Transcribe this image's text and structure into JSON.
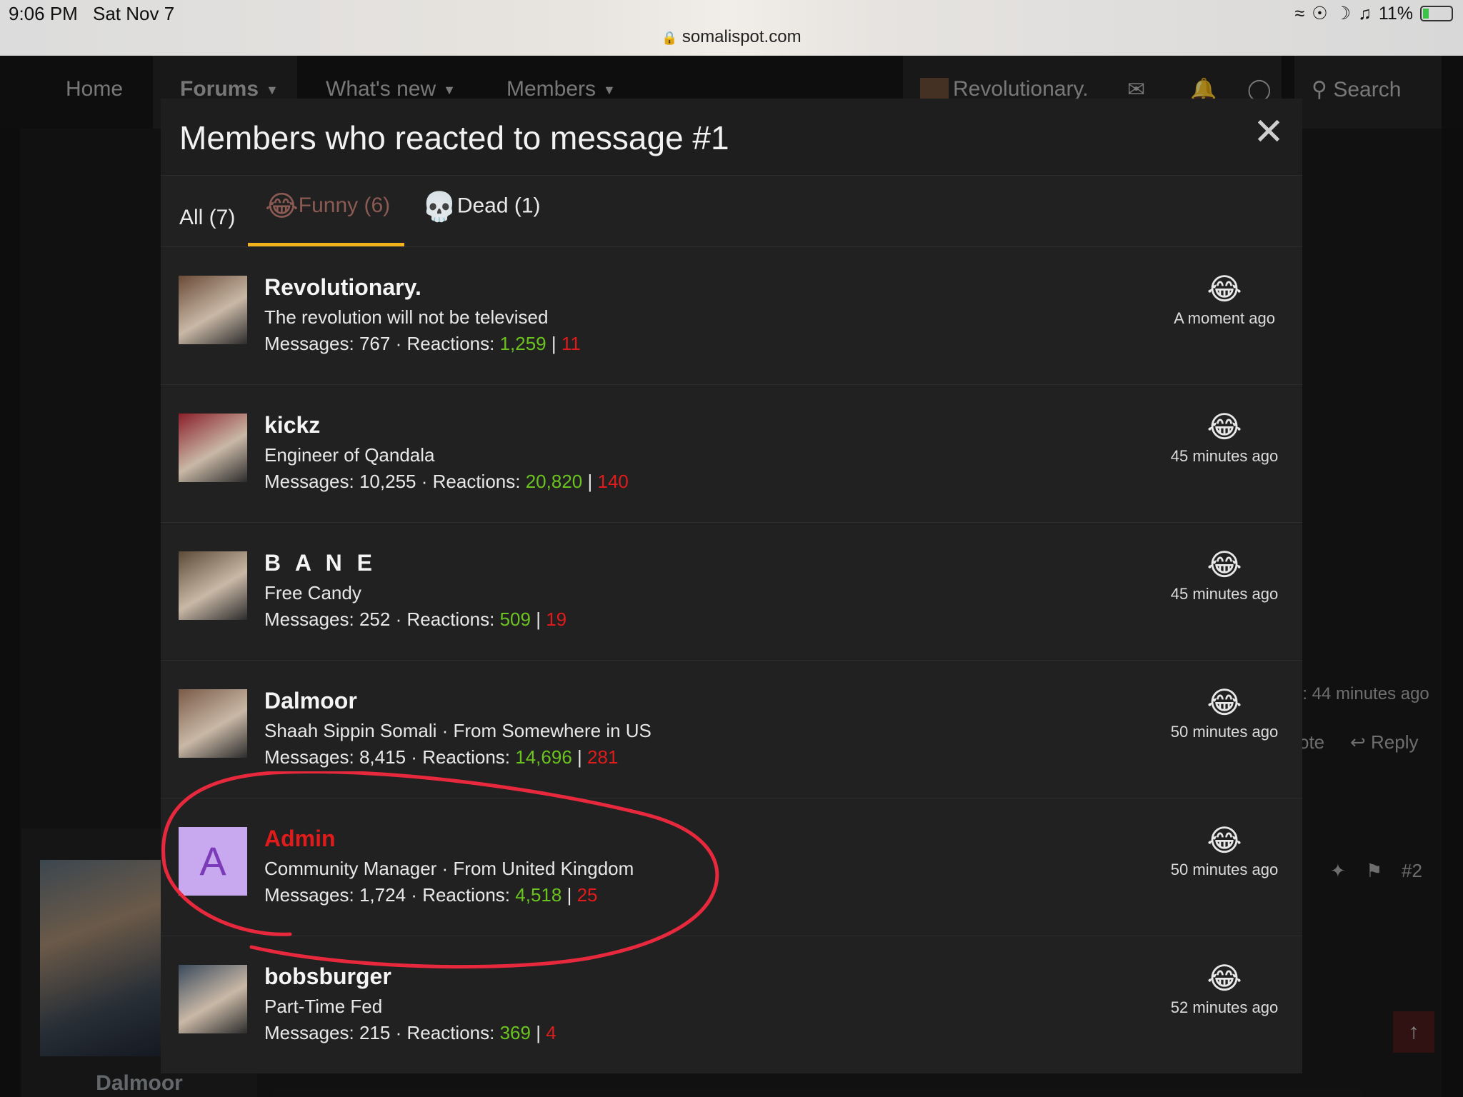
{
  "status_bar": {
    "time": "9:06 PM",
    "date": "Sat Nov 7",
    "battery": "11%",
    "url": "somalispot.com"
  },
  "nav": {
    "home": "Home",
    "forums": "Forums",
    "whats_new": "What's new",
    "members": "Members",
    "user": "Revolutionary.",
    "search": "Search"
  },
  "background": {
    "meta_time": "l: 44 minutes ago",
    "quote": "ote",
    "reply": "Reply",
    "post_number": "#2",
    "author": "Dalmoor"
  },
  "modal": {
    "title": "Members who reacted to message #1",
    "tabs": [
      {
        "label": "All (7)"
      },
      {
        "label": "Funny (6)",
        "emoji": "😂"
      },
      {
        "label": "Dead (1)",
        "emoji": "💀"
      }
    ]
  },
  "members": [
    {
      "name": "Revolutionary.",
      "title": "The revolution will not be televised",
      "messages": "767",
      "reactions_pos": "1,259",
      "reactions_neg": "11",
      "reaction": "😂",
      "when": "A moment ago",
      "avatar_color": "#6a4a38"
    },
    {
      "name": "kickz",
      "title": "Engineer of Qandala",
      "messages": "10,255",
      "reactions_pos": "20,820",
      "reactions_neg": "140",
      "reaction": "😂",
      "when": "45 minutes ago",
      "avatar_color": "#8a1f2a"
    },
    {
      "name": "B A N E",
      "title": "Free Candy",
      "messages": "252",
      "reactions_pos": "509",
      "reactions_neg": "19",
      "reaction": "😂",
      "when": "45 minutes ago",
      "avatar_color": "#5c4a38"
    },
    {
      "name": "Dalmoor",
      "title": "Shaah Sippin Somali · From Somewhere in US",
      "messages": "8,415",
      "reactions_pos": "14,696",
      "reactions_neg": "281",
      "reaction": "😂",
      "when": "50 minutes ago",
      "avatar_color": "#7a5a48"
    },
    {
      "name": "Admin",
      "title": "Community Manager · From United Kingdom",
      "messages": "1,724",
      "reactions_pos": "4,518",
      "reactions_neg": "25",
      "reaction": "😂",
      "when": "50 minutes ago",
      "avatar_letter": "A",
      "avatar_color": "#c8a8ef"
    },
    {
      "name": "bobsburger",
      "title": "Part-Time Fed",
      "messages": "215",
      "reactions_pos": "369",
      "reactions_neg": "4",
      "reaction": "😂",
      "when": "52 minutes ago",
      "avatar_color": "#3a4a5c"
    }
  ],
  "labels": {
    "messages": "Messages:",
    "reactions": "Reactions:",
    "sep_dot": "·",
    "sep_bar": "|"
  },
  "colors": {
    "accent": "#f2b21b",
    "positive": "#6bc320",
    "negative": "#e01b1b",
    "annotation": "#e8283c"
  }
}
